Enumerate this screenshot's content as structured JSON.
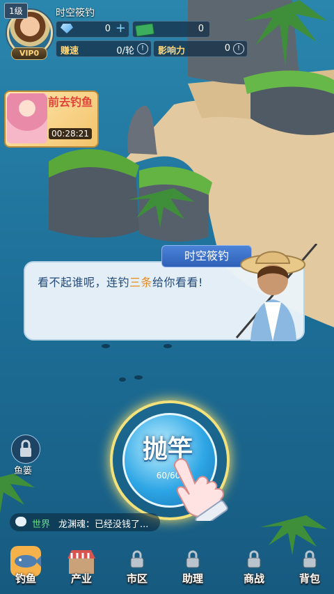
{
  "player": {
    "level": "1级",
    "name": "时空筱钓",
    "vip": "VIP0",
    "gems": "0",
    "cash": "0",
    "earn_label": "赚速",
    "earn_value": "0/轮",
    "influence_label": "影响力",
    "influence_value": "0"
  },
  "event": {
    "title": "前去钓鱼",
    "timer": "00:28:21"
  },
  "dialog": {
    "speaker": "时空筱钓",
    "text_before": "看不起谁呢，连钓",
    "text_highlight": "三条",
    "text_after": "给你看看!"
  },
  "cast": {
    "label": "抛竿",
    "count": "60/60"
  },
  "side": {
    "fishbasket_label": "鱼篓"
  },
  "chat": {
    "channel": "世界",
    "message": "龙渊魂：已经没钱了..."
  },
  "nav": [
    {
      "label": "钓鱼",
      "locked": false,
      "active": true
    },
    {
      "label": "产业",
      "locked": false,
      "active": false
    },
    {
      "label": "市区",
      "locked": true,
      "active": false
    },
    {
      "label": "助理",
      "locked": true,
      "active": false
    },
    {
      "label": "商战",
      "locked": true,
      "active": false
    },
    {
      "label": "背包",
      "locked": true,
      "active": false
    }
  ],
  "colors": {
    "sea": "#1f6f97",
    "sand": "#e3c9a0",
    "grass": "#5aa83a",
    "dialog_text": "#234a79",
    "highlight": "#e98a1c",
    "cast_ring": "#f3e27b"
  }
}
